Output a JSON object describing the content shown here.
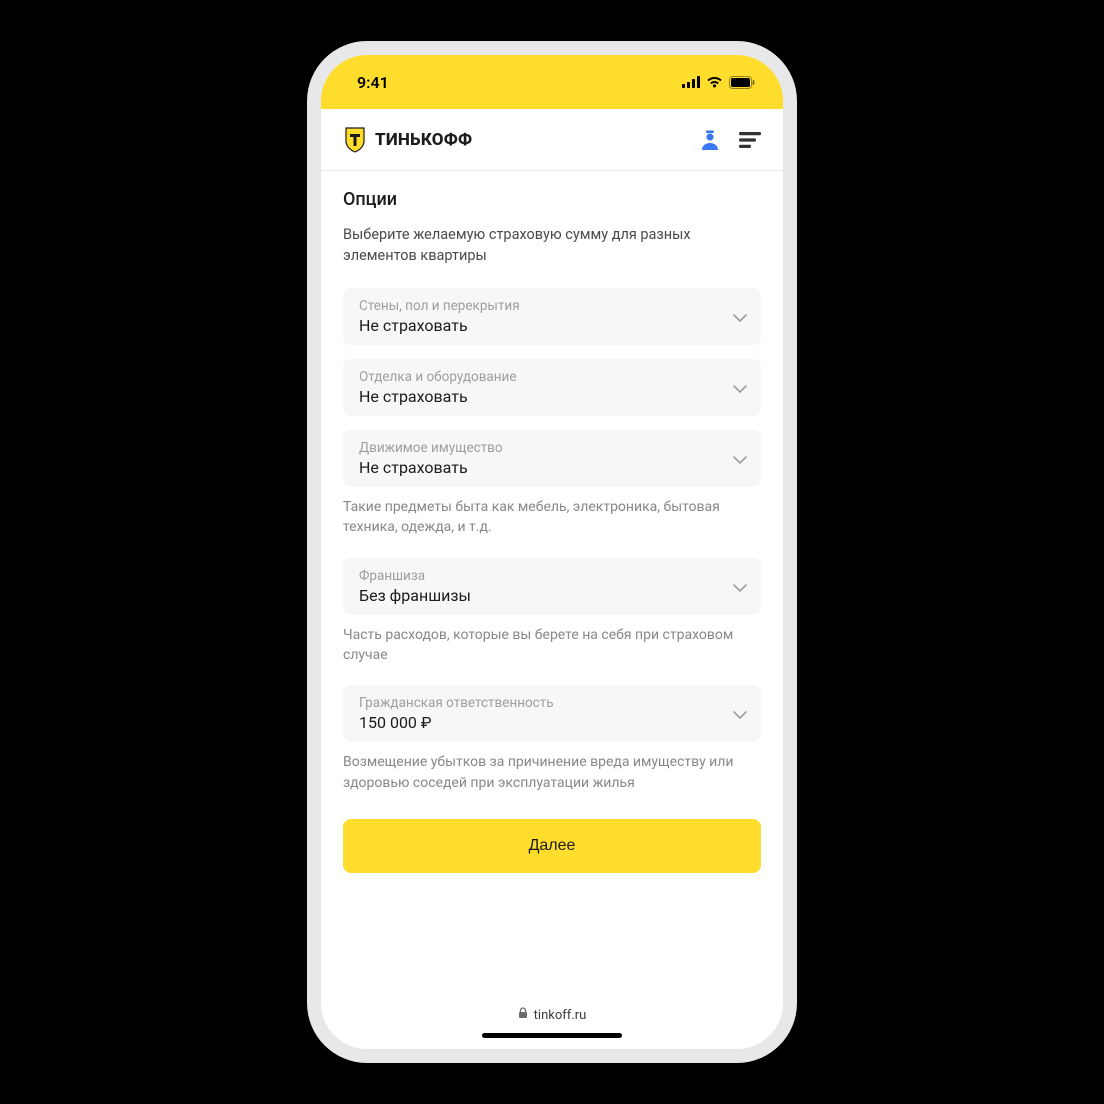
{
  "statusBar": {
    "time": "9:41"
  },
  "nav": {
    "brand": "ТИНЬКОФФ"
  },
  "page": {
    "title": "Опции",
    "subtitle": "Выберите желаемую страховую сумму для разных элементов квартиры"
  },
  "options": {
    "walls": {
      "label": "Стены, пол и перекрытия",
      "value": "Не страховать"
    },
    "finish": {
      "label": "Отделка и оборудование",
      "value": "Не страховать"
    },
    "movable": {
      "label": "Движимое имущество",
      "value": "Не страховать",
      "help": "Такие предметы быта как мебель, электроника, бытовая техника, одежда, и т.д."
    },
    "franchise": {
      "label": "Франшиза",
      "value": "Без франшизы",
      "help": "Часть расходов, которые вы берете на себя при страховом случае"
    },
    "liability": {
      "label": "Гражданская ответственность",
      "value": "150 000 ₽",
      "help": "Возмещение убытков за причинение вреда имуществу или здоровью соседей при эксплуатации жилья"
    }
  },
  "actions": {
    "next": "Далее"
  },
  "browser": {
    "domain": "tinkoff.ru"
  }
}
